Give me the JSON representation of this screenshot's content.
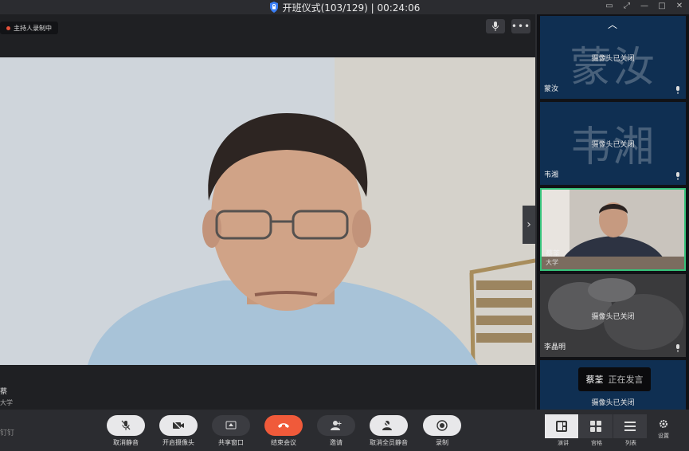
{
  "window": {
    "title": "开班仪式(103/129) | 00:24:06"
  },
  "main": {
    "recording_badge": "主持人录制中",
    "speaker_name": "蔡",
    "speaker_org": "大学"
  },
  "sidebar": {
    "tiles": [
      {
        "big_text": "蒙汝",
        "status": "摄像头已关闭",
        "name": "蒙汝"
      },
      {
        "big_text": "韦湘",
        "status": "摄像头已关闭",
        "name": "韦湘"
      },
      {
        "big_text": "",
        "status": "",
        "name": "蔡荃",
        "org": "大学"
      },
      {
        "big_text": "",
        "status": "摄像头已关闭",
        "name": "李晶明"
      },
      {
        "big_text": "",
        "status": "摄像头已关闭",
        "name": ""
      }
    ],
    "speaking": {
      "who": "蔡荃",
      "what": "正在发言"
    }
  },
  "toolbar": {
    "left_text": "钉钉",
    "buttons": [
      {
        "label": "取消静音"
      },
      {
        "label": "开启摄像头"
      },
      {
        "label": "共享窗口"
      },
      {
        "label": "结束会议"
      },
      {
        "label": "邀请"
      },
      {
        "label": "取消全员静音"
      },
      {
        "label": "录制"
      }
    ],
    "views": [
      {
        "label": "演讲"
      },
      {
        "label": "宫格"
      },
      {
        "label": "列表"
      }
    ],
    "settings_label": "设置"
  },
  "colors": {
    "accent_green": "#35c27a",
    "end_red": "#f05a3a",
    "tile_blue": "#0f2f52"
  }
}
